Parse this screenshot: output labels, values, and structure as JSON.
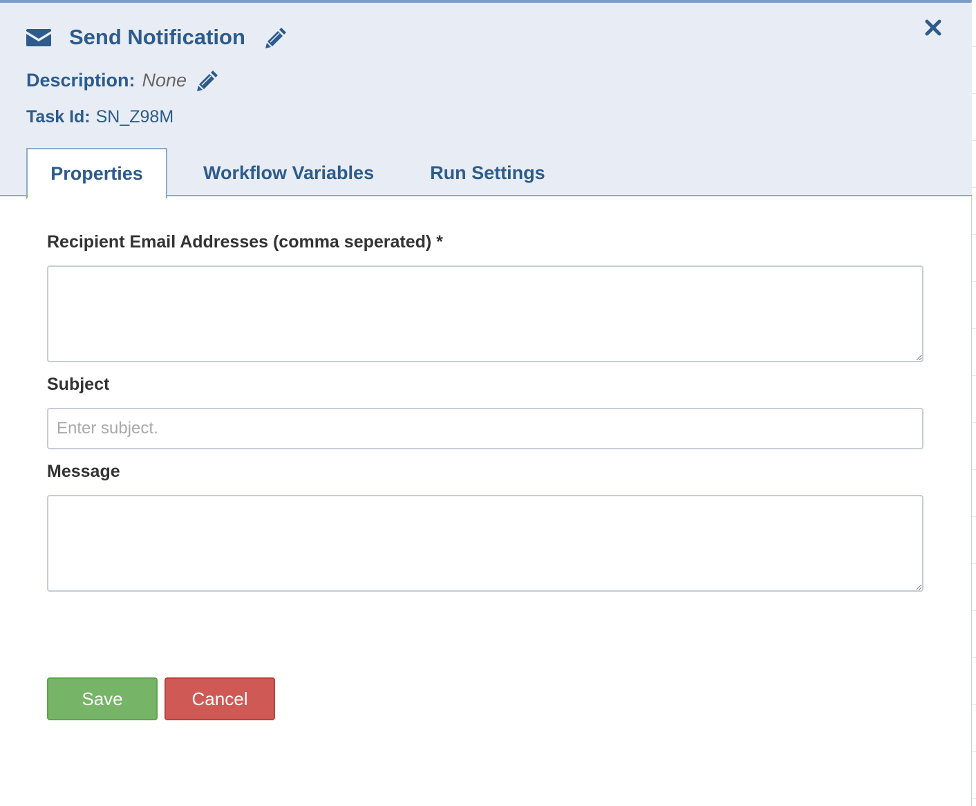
{
  "header": {
    "title": "Send Notification",
    "description_label": "Description:",
    "description_value": "None",
    "task_id_label": "Task Id:",
    "task_id_value": "SN_Z98M"
  },
  "icons": {
    "title_icon": "envelope-icon",
    "edit_icon": "pencil-icon",
    "close_icon": "close-icon"
  },
  "tabs": [
    {
      "label": "Properties",
      "active": true
    },
    {
      "label": "Workflow Variables",
      "active": false
    },
    {
      "label": "Run Settings",
      "active": false
    }
  ],
  "form": {
    "recipients": {
      "label": "Recipient Email Addresses (comma seperated) *",
      "value": ""
    },
    "subject": {
      "label": "Subject",
      "placeholder": "Enter subject.",
      "value": ""
    },
    "message": {
      "label": "Message",
      "value": ""
    }
  },
  "buttons": {
    "save_label": "Save",
    "cancel_label": "Cancel"
  },
  "colors": {
    "accent": "#2d5b8c",
    "header_bg": "#e8edf5",
    "save": "#76b567",
    "cancel": "#cf5a55"
  }
}
